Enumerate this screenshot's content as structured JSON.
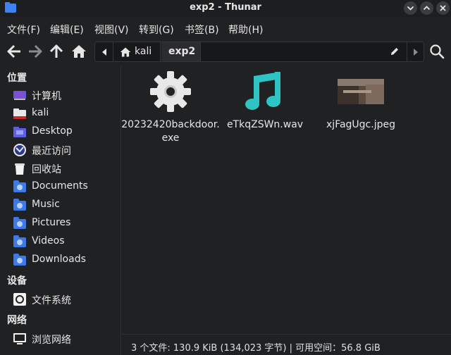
{
  "window": {
    "title": "exp2 - Thunar"
  },
  "menu": [
    "文件(F)",
    "编辑(E)",
    "视图(V)",
    "转到(G)",
    "书签(B)",
    "帮助(H)"
  ],
  "pathbar": {
    "crumbs": [
      "kali",
      "exp2"
    ]
  },
  "sidebar": {
    "sections": [
      {
        "title": "位置",
        "items": [
          {
            "label": "计算机",
            "icon": "computer-icon"
          },
          {
            "label": "kali",
            "icon": "home-folder-icon"
          },
          {
            "label": "Desktop",
            "icon": "desktop-folder-icon"
          },
          {
            "label": "最近访问",
            "icon": "recent-icon"
          },
          {
            "label": "回收站",
            "icon": "trash-icon"
          },
          {
            "label": "Documents",
            "icon": "documents-folder-icon"
          },
          {
            "label": "Music",
            "icon": "music-folder-icon"
          },
          {
            "label": "Pictures",
            "icon": "pictures-folder-icon"
          },
          {
            "label": "Videos",
            "icon": "videos-folder-icon"
          },
          {
            "label": "Downloads",
            "icon": "downloads-folder-icon"
          }
        ]
      },
      {
        "title": "设备",
        "items": [
          {
            "label": "文件系统",
            "icon": "drive-icon"
          }
        ]
      },
      {
        "title": "网络",
        "items": [
          {
            "label": "浏览网络",
            "icon": "network-icon"
          }
        ]
      }
    ]
  },
  "files": [
    {
      "name": "20232420backdoor.exe",
      "icon": "gear-icon"
    },
    {
      "name": "eTkqZSWn.wav",
      "icon": "music-note-icon"
    },
    {
      "name": "xjFagUgc.jpeg",
      "icon": "image-thumbnail"
    }
  ],
  "status": "3 个文件: 130.9 KiB (134,023 字节) | 可用空间：56.8 GiB",
  "colors": {
    "background": "#202123",
    "accent": "#3d7ae8",
    "music": "#2ec4c4"
  }
}
